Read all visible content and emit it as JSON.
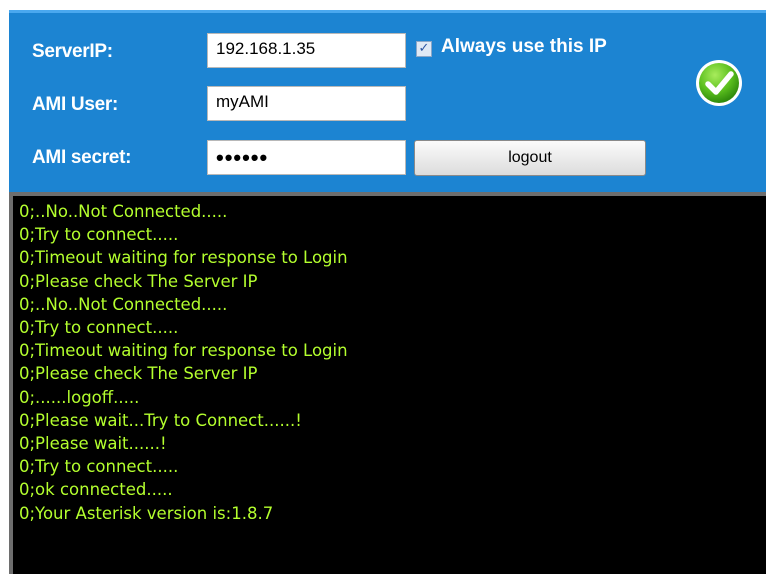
{
  "form": {
    "server_ip_label": "ServerIP:",
    "server_ip_value": "192.168.1.35",
    "ami_user_label": "AMI User:",
    "ami_user_value": "myAMI",
    "ami_secret_label": "AMI secret:",
    "ami_secret_masked": "••••••",
    "always_use_label": "Always use this IP",
    "always_use_checked": true,
    "logout_label": "logout",
    "status_icon": "checkmark-circle-icon"
  },
  "colors": {
    "panel_background": "#1c84d2",
    "console_background": "#000000",
    "console_text": "#b4ff2e",
    "ok_icon_green": "#5bbf1e"
  },
  "console": {
    "lines": [
      "0;..No..Not Connected.....",
      "0;Try to connect.....",
      "0;Timeout waiting for response to Login",
      "0;Please check The Server IP",
      "0;..No..Not Connected.....",
      "0;Try to connect.....",
      "0;Timeout waiting for response to Login",
      "0;Please check The Server IP",
      "0;......logoff.....",
      "0;Please wait...Try to Connect......!",
      "0;Please wait......!",
      "0;Try to connect.....",
      "0;ok connected.....",
      "0;Your Asterisk version is:1.8.7"
    ]
  }
}
